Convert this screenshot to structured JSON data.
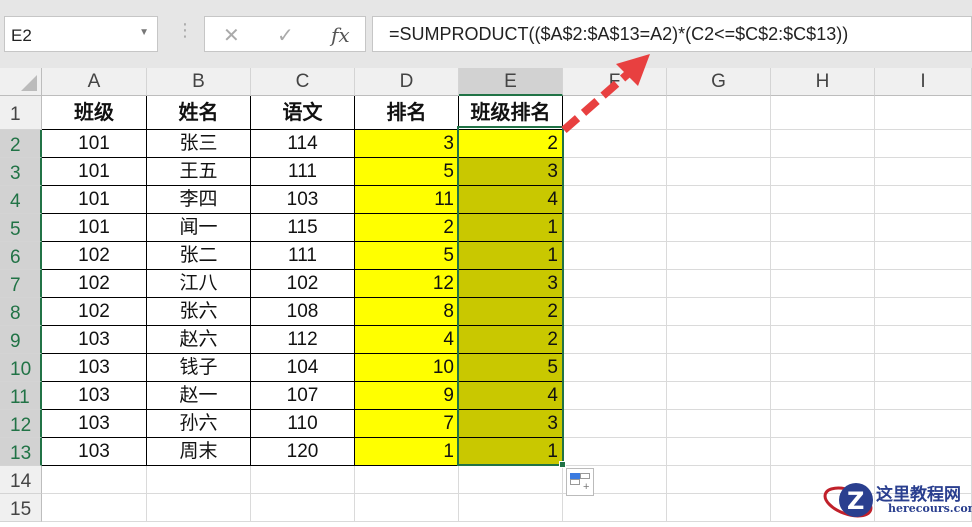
{
  "name_box": "E2",
  "formula_bar": {
    "cancel_icon": "✕",
    "enter_icon": "✓",
    "fx_label": "fx",
    "formula": "=SUMPRODUCT(($A$2:$A$13=A2)*(C2<=$C$2:$C$13))"
  },
  "columns": [
    "A",
    "B",
    "C",
    "D",
    "E",
    "F",
    "G",
    "H",
    "I"
  ],
  "rows": [
    "1",
    "2",
    "3",
    "4",
    "5",
    "6",
    "7",
    "8",
    "9",
    "10",
    "11",
    "12",
    "13",
    "14",
    "15"
  ],
  "headers": [
    "班级",
    "姓名",
    "语文",
    "排名",
    "班级排名"
  ],
  "data": [
    [
      "101",
      "张三",
      "114",
      "3",
      "2"
    ],
    [
      "101",
      "王五",
      "111",
      "5",
      "3"
    ],
    [
      "101",
      "李四",
      "103",
      "11",
      "4"
    ],
    [
      "101",
      "闻一",
      "115",
      "2",
      "1"
    ],
    [
      "102",
      "张二",
      "111",
      "5",
      "1"
    ],
    [
      "102",
      "江八",
      "102",
      "12",
      "3"
    ],
    [
      "102",
      "张六",
      "108",
      "8",
      "2"
    ],
    [
      "103",
      "赵六",
      "112",
      "4",
      "2"
    ],
    [
      "103",
      "钱子",
      "104",
      "10",
      "5"
    ],
    [
      "103",
      "赵一",
      "107",
      "9",
      "4"
    ],
    [
      "103",
      "孙六",
      "110",
      "7",
      "3"
    ],
    [
      "103",
      "周末",
      "120",
      "1",
      "1"
    ]
  ],
  "watermark": {
    "title": "这里教程网",
    "url": "herecours.com"
  },
  "colors": {
    "selection": "#217346",
    "highlight_yellow": "#ffff00",
    "highlight_olive": "#c9c800",
    "arrow": "#e84040"
  }
}
